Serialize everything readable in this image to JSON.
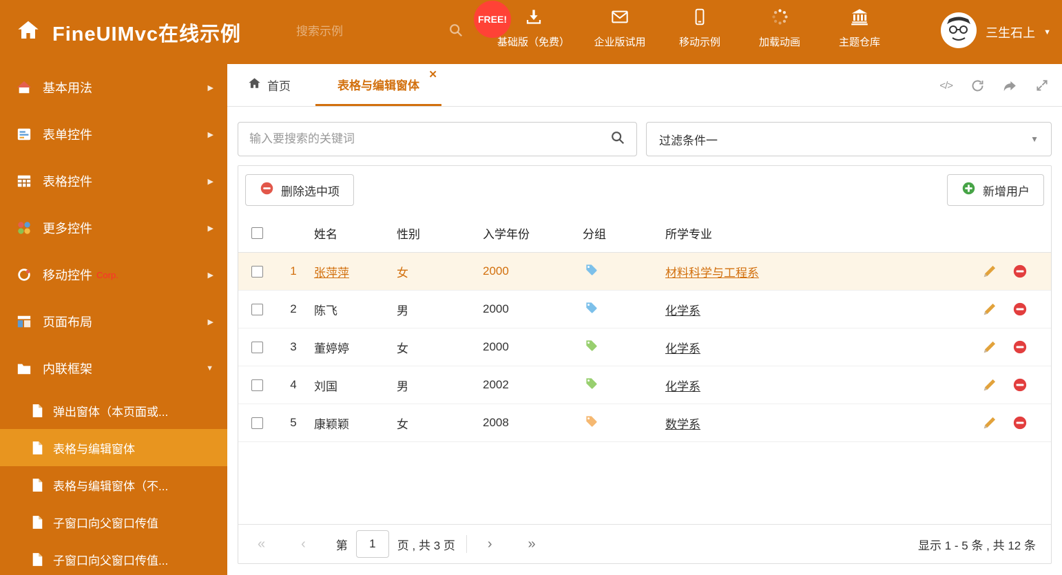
{
  "header": {
    "title": "FineUIMvc在线示例",
    "search_placeholder": "搜索示例",
    "free_badge": "FREE!",
    "nav": [
      {
        "label": "基础版（免费）"
      },
      {
        "label": "企业版试用"
      },
      {
        "label": "移动示例"
      },
      {
        "label": "加载动画"
      },
      {
        "label": "主题仓库"
      }
    ],
    "user_name": "三生石上"
  },
  "sidebar": {
    "items": [
      {
        "label": "基本用法"
      },
      {
        "label": "表单控件"
      },
      {
        "label": "表格控件"
      },
      {
        "label": "更多控件"
      },
      {
        "label": "移动控件",
        "badge": "Corp."
      },
      {
        "label": "页面布局"
      },
      {
        "label": "内联框架"
      }
    ],
    "subitems": [
      {
        "label": "弹出窗体（本页面或..."
      },
      {
        "label": "表格与编辑窗体"
      },
      {
        "label": "表格与编辑窗体（不..."
      },
      {
        "label": "子窗口向父窗口传值"
      },
      {
        "label": "子窗口向父窗口传值..."
      }
    ]
  },
  "tabs": {
    "home_label": "首页",
    "active_label": "表格与编辑窗体"
  },
  "filter": {
    "search_placeholder": "输入要搜索的关键词",
    "selected_filter": "过滤条件一"
  },
  "toolbar": {
    "delete_label": "删除选中项",
    "add_label": "新增用户"
  },
  "table": {
    "columns": {
      "name": "姓名",
      "gender": "性别",
      "year": "入学年份",
      "group": "分组",
      "major": "所学专业"
    },
    "rows": [
      {
        "num": "1",
        "name": "张萍萍",
        "gender": "女",
        "year": "2000",
        "tag_color": "#7cc0ea",
        "major": "材料科学与工程系"
      },
      {
        "num": "2",
        "name": "陈飞",
        "gender": "男",
        "year": "2000",
        "tag_color": "#7cc0ea",
        "major": "化学系"
      },
      {
        "num": "3",
        "name": "董婷婷",
        "gender": "女",
        "year": "2000",
        "tag_color": "#98cf6f",
        "major": "化学系"
      },
      {
        "num": "4",
        "name": "刘国",
        "gender": "男",
        "year": "2002",
        "tag_color": "#98cf6f",
        "major": "化学系"
      },
      {
        "num": "5",
        "name": "康颖颖",
        "gender": "女",
        "year": "2008",
        "tag_color": "#f5b871",
        "major": "数学系"
      }
    ]
  },
  "pagination": {
    "page_prefix": "第",
    "page_input": "1",
    "page_suffix": "页 , 共 3 页",
    "first": "«",
    "prev": "‹",
    "next": "›",
    "last": "»",
    "summary": "显示 1 - 5 条 , 共 12 条"
  },
  "colors": {
    "accent": "#d2700e",
    "sidebar_active_bg": "#e8951f",
    "selected_row_bg": "#fdf5e6",
    "free_badge_bg": "#ff4236",
    "delete_icon": "#e2574a",
    "add_icon": "#47a447",
    "edit_icon": "#e2a23b",
    "remove_icon": "#e23e3e"
  }
}
